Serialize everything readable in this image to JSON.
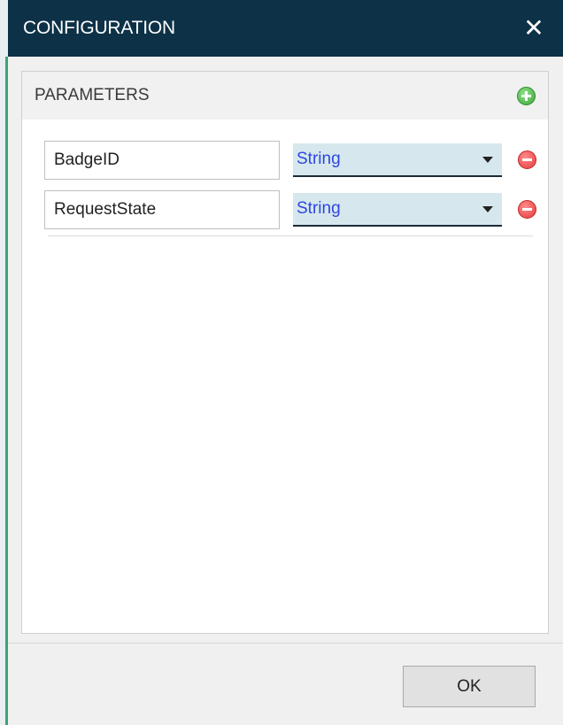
{
  "dialog": {
    "title": "CONFIGURATION",
    "close_icon": "close-icon"
  },
  "parameters": {
    "header": "PARAMETERS",
    "add_icon": "plus-circle-icon",
    "rows": [
      {
        "name": "BadgeID",
        "type": "String",
        "remove_icon": "minus-circle-icon"
      },
      {
        "name": "RequestState",
        "type": "String",
        "remove_icon": "minus-circle-icon"
      }
    ]
  },
  "footer": {
    "ok_label": "OK"
  },
  "colors": {
    "titlebar": "#0d3147",
    "select_bg": "#d6e8ee",
    "select_text": "#2f47e0",
    "add_green": "#3da83a",
    "remove_red": "#e43b3b"
  }
}
